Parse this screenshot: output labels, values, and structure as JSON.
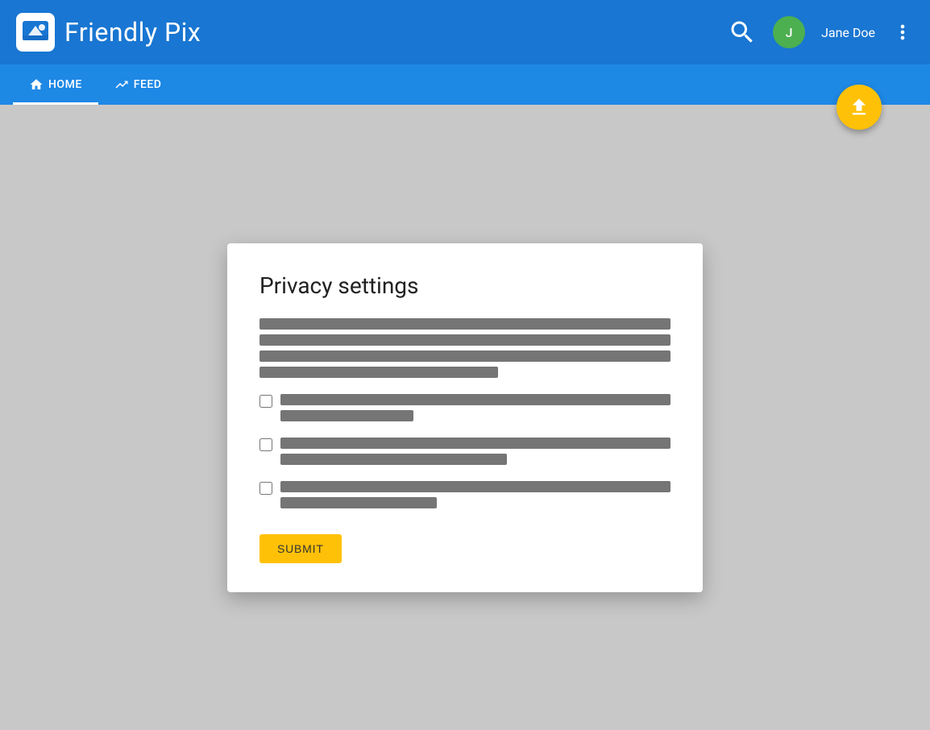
{
  "app": {
    "title": "Friendly Pix",
    "logo_alt": "Friendly Pix logo"
  },
  "header": {
    "user_name": "Jane Doe",
    "search_label": "search",
    "more_label": "more options"
  },
  "secondary_nav": {
    "tabs": [
      {
        "id": "home",
        "label": "HOME",
        "icon": "home-icon",
        "active": true
      },
      {
        "id": "feed",
        "label": "FEED",
        "icon": "feed-icon",
        "active": false
      }
    ],
    "upload_label": "upload"
  },
  "dialog": {
    "title": "Privacy settings",
    "description_lines": [
      {
        "width": "100%",
        "id": "line1"
      },
      {
        "width": "100%",
        "id": "line2"
      },
      {
        "width": "100%",
        "id": "line3"
      },
      {
        "width": "58%",
        "id": "line4"
      }
    ],
    "checkboxes": [
      {
        "id": "cb1",
        "checked": false,
        "line1_width": "100%",
        "line2_width": "32%"
      },
      {
        "id": "cb2",
        "checked": false,
        "line1_width": "100%",
        "line2_width": "58%"
      },
      {
        "id": "cb3",
        "checked": false,
        "line1_width": "100%",
        "line2_width": "40%"
      }
    ],
    "submit_label": "SUBMIT"
  }
}
